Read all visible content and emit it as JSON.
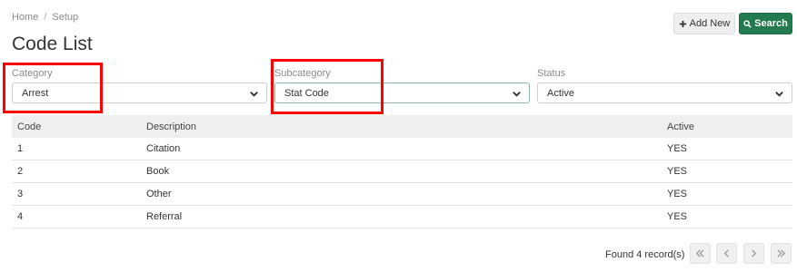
{
  "breadcrumb": {
    "home": "Home",
    "separator": "/",
    "current": "Setup"
  },
  "page_title": "Code List",
  "toolbar": {
    "add_new_label": "Add New",
    "search_label": "Search"
  },
  "filters": {
    "category": {
      "label": "Category",
      "value": "Arrest"
    },
    "subcategory": {
      "label": "Subcategory",
      "value": "Stat Code"
    },
    "status": {
      "label": "Status",
      "value": "Active"
    }
  },
  "table": {
    "headers": [
      "Code",
      "Description",
      "Active"
    ],
    "rows": [
      [
        "1",
        "Citation",
        "YES"
      ],
      [
        "2",
        "Book",
        "YES"
      ],
      [
        "3",
        "Other",
        "YES"
      ],
      [
        "4",
        "Referral",
        "YES"
      ]
    ]
  },
  "pagination": {
    "found_text": "Found 4 record(s)"
  },
  "colors": {
    "search_button": "#237a4f",
    "highlight": "#ff0000",
    "header_bg": "#efefef"
  }
}
